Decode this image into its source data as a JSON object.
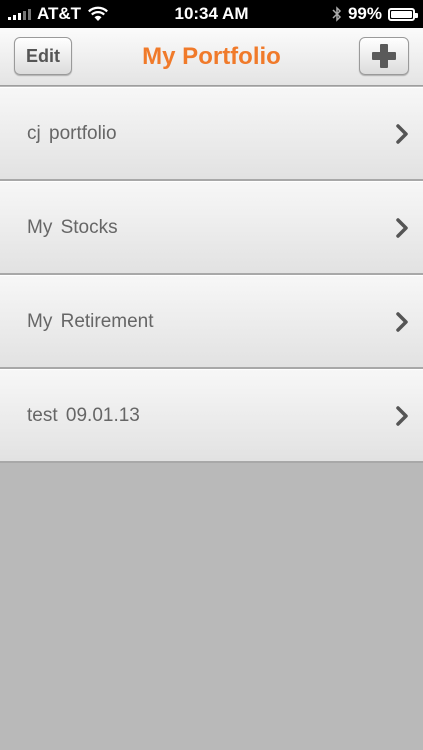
{
  "status_bar": {
    "carrier": "AT&T",
    "time": "10:34 AM",
    "battery": "99%",
    "battery_level": 0.99
  },
  "nav": {
    "title": "My Portfolio",
    "edit_label": "Edit",
    "add_icon": "plus-icon"
  },
  "colors": {
    "title": "#f07a2a"
  },
  "portfolios": [
    {
      "label": "cj  portfolio"
    },
    {
      "label": "My  Stocks"
    },
    {
      "label": "My  Retirement"
    },
    {
      "label": "test  09.01.13"
    }
  ]
}
